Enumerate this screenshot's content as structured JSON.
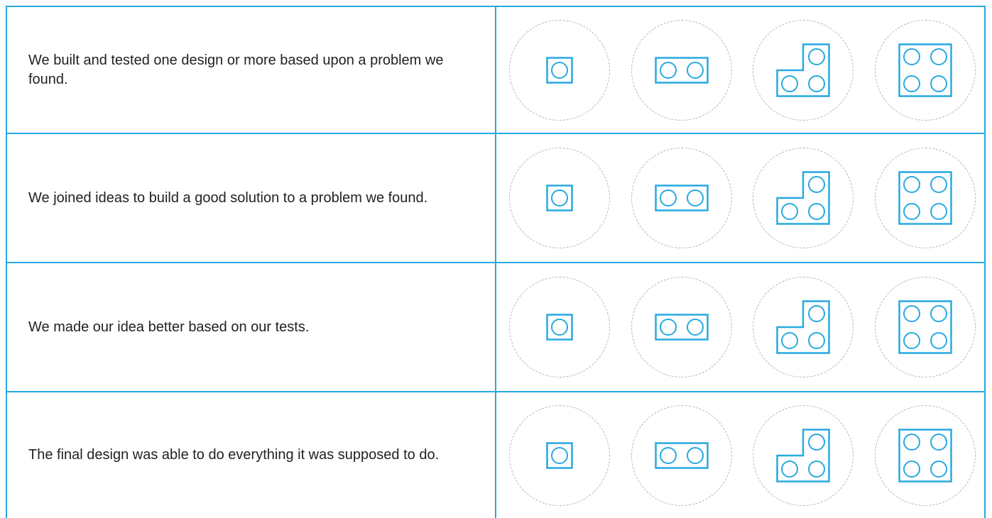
{
  "rubric": {
    "rows": [
      {
        "statement": "We built and tested one design or more based upon a problem we found."
      },
      {
        "statement": "We joined ideas to build a good solution to a problem we found."
      },
      {
        "statement": "We made our idea better based on our tests."
      },
      {
        "statement": "The final design was able to do everything it was supposed to do."
      }
    ],
    "levels": [
      {
        "icon": "brick-1x1-icon",
        "studs": 1
      },
      {
        "icon": "brick-1x2-icon",
        "studs": 2
      },
      {
        "icon": "brick-l-shape-icon",
        "studs": 3
      },
      {
        "icon": "brick-2x2-icon",
        "studs": 4
      }
    ]
  },
  "colors": {
    "accent": "#27a9e1",
    "dashed_circle": "#b5b5b5",
    "text": "#222222"
  }
}
